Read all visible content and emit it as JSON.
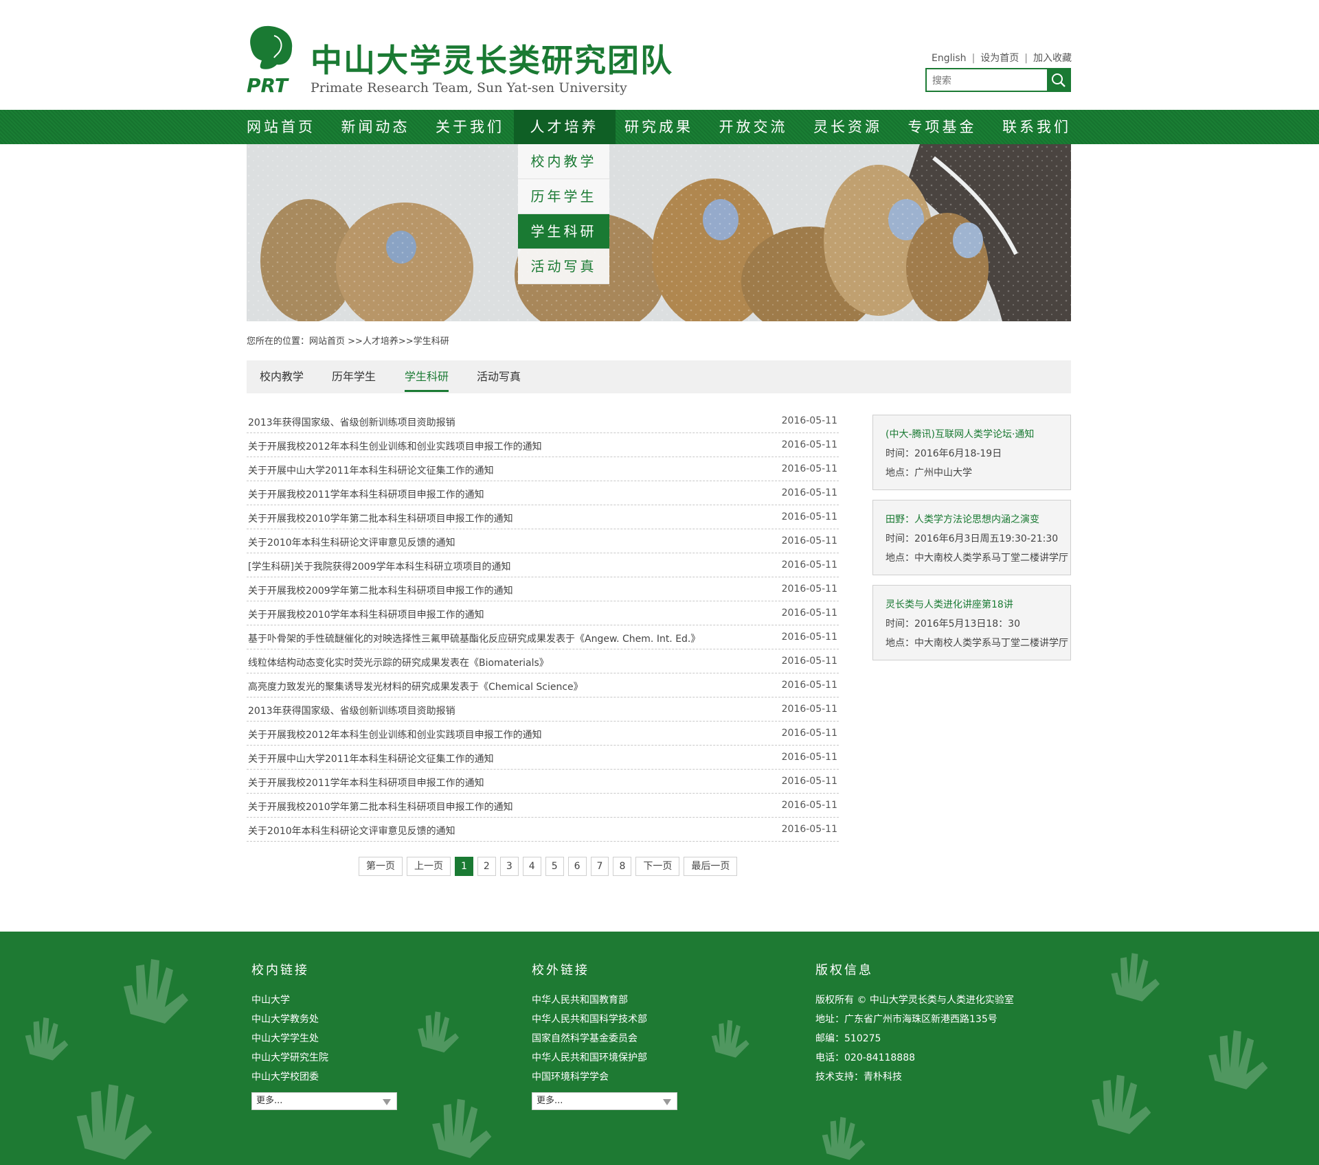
{
  "header": {
    "logo_mark": "PRT",
    "title_cn": "中山大学灵长类研究团队",
    "title_en": "Primate Research Team, Sun Yat-sen University",
    "links": [
      "English",
      "设为首页",
      "加入收藏"
    ],
    "search_placeholder": "搜索"
  },
  "nav": {
    "items": [
      "网站首页",
      "新闻动态",
      "关于我们",
      "人才培养",
      "研究成果",
      "开放交流",
      "灵长资源",
      "专项基金",
      "联系我们"
    ],
    "active": "人才培养",
    "dropdown": [
      "校内教学",
      "历年学生",
      "学生科研",
      "活动写真"
    ],
    "dropdown_active": "学生科研"
  },
  "breadcrumb": "您所在的位置：网站首页 >>人才培养>>学生科研",
  "subtabs": {
    "items": [
      "校内教学",
      "历年学生",
      "学生科研",
      "活动写真"
    ],
    "active": "学生科研"
  },
  "list": [
    {
      "title": "2013年获得国家级、省级创新训练项目资助报销",
      "date": "2016-05-11"
    },
    {
      "title": "关于开展我校2012年本科生创业训练和创业实践项目申报工作的通知",
      "date": "2016-05-11"
    },
    {
      "title": "关于开展中山大学2011年本科生科研论文征集工作的通知",
      "date": "2016-05-11"
    },
    {
      "title": "关于开展我校2011学年本科生科研项目申报工作的通知",
      "date": "2016-05-11"
    },
    {
      "title": "关于开展我校2010学年第二批本科生科研项目申报工作的通知",
      "date": "2016-05-11"
    },
    {
      "title": "关于2010年本科生科研论文评审意见反馈的通知",
      "date": "2016-05-11"
    },
    {
      "title": "[学生科研]关于我院获得2009学年本科生科研立项项目的通知",
      "date": "2016-05-11"
    },
    {
      "title": "关于开展我校2009学年第二批本科生科研项目申报工作的通知",
      "date": "2016-05-11"
    },
    {
      "title": "关于开展我校2010学年本科生科研项目申报工作的通知",
      "date": "2016-05-11"
    },
    {
      "title": "基于卟骨架的手性硫醚催化的对映选择性三氟甲硫基酯化反应研究成果发表于《Angew. Chem. Int. Ed.》",
      "date": "2016-05-11"
    },
    {
      "title": "线粒体结构动态变化实时荧光示踪的研究成果发表在《Biomaterials》",
      "date": "2016-05-11"
    },
    {
      "title": "高亮度力致发光的聚集诱导发光材料的研究成果发表于《Chemical Science》",
      "date": "2016-05-11"
    },
    {
      "title": "2013年获得国家级、省级创新训练项目资助报销",
      "date": "2016-05-11"
    },
    {
      "title": "关于开展我校2012年本科生创业训练和创业实践项目申报工作的通知",
      "date": "2016-05-11"
    },
    {
      "title": "关于开展中山大学2011年本科生科研论文征集工作的通知",
      "date": "2016-05-11"
    },
    {
      "title": "关于开展我校2011学年本科生科研项目申报工作的通知",
      "date": "2016-05-11"
    },
    {
      "title": "关于开展我校2010学年第二批本科生科研项目申报工作的通知",
      "date": "2016-05-11"
    },
    {
      "title": "关于2010年本科生科研论文评审意见反馈的通知",
      "date": "2016-05-11"
    }
  ],
  "pager": {
    "first": "第一页",
    "prev": "上一页",
    "pages": [
      "1",
      "2",
      "3",
      "4",
      "5",
      "6",
      "7",
      "8"
    ],
    "current": "1",
    "next": "下一页",
    "last": "最后一页"
  },
  "side_cards": [
    {
      "title": "(中大-腾讯)互联网人类学论坛·通知",
      "time": "时间：2016年6月18-19日",
      "place": "地点：广州中山大学"
    },
    {
      "title": "田野：人类学方法论思想内涵之演变",
      "time": "时间：2016年6月3日周五19:30-21:30",
      "place": "地点：中大南校人类学系马丁堂二楼讲学厅"
    },
    {
      "title": "灵长类与人类进化讲座第18讲",
      "time": "时间：2016年5月13日18：30",
      "place": "地点：中大南校人类学系马丁堂二楼讲学厅"
    }
  ],
  "footer": {
    "internal": {
      "title": "校内链接",
      "links": [
        "中山大学",
        "中山大学教务处",
        "中山大学学生处",
        "中山大学研究生院",
        "中山大学校团委"
      ],
      "select": "更多..."
    },
    "external": {
      "title": "校外链接",
      "links": [
        "中华人民共和国教育部",
        "中华人民共和国科学技术部",
        "国家自然科学基金委员会",
        "中华人民共和国环境保护部",
        "中国环境科学学会"
      ],
      "select": "更多..."
    },
    "copyright": {
      "title": "版权信息",
      "lines": [
        "版权所有 © 中山大学灵长类与人类进化实验室",
        "地址：广东省广州市海珠区新港西路135号",
        "邮编：510275",
        "电话：020-84118888",
        "技术支持：青朴科技"
      ]
    }
  },
  "colors": {
    "brand": "#1a7a33",
    "nav_active": "#0f5f25",
    "footer": "#1e7a33"
  },
  "icons": {
    "search": "magnifier-icon",
    "logo": "primate-head-logo-icon"
  }
}
